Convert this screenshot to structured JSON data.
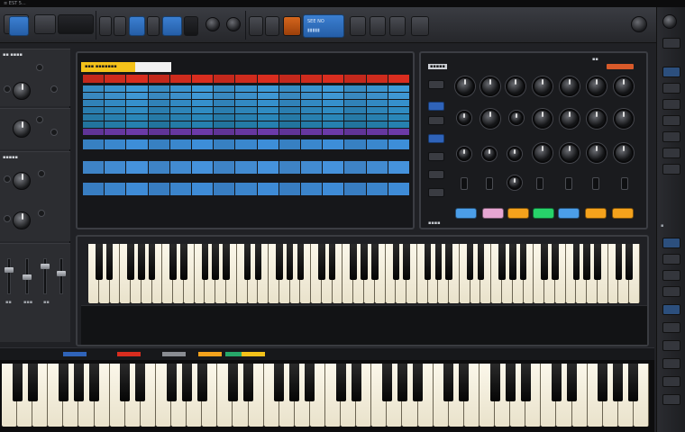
{
  "menu": {
    "text": "≡ EST 5..."
  },
  "toolbar": {
    "tab_label": "SEE NO",
    "tab_sub": "▮▮▮▮▮"
  },
  "left_panel": {
    "section_1_title": "▪▪ ▪▪▪▪",
    "section_2_title": "▪▪▪▪▪",
    "fader_labels": [
      "▪▪",
      "▪▪▪",
      "▪▪"
    ]
  },
  "grid": {
    "header_tag": "▪▪▪ ▪▪▪▪▪▪▪",
    "columns": 15,
    "rows": [
      {
        "color": "#d92d1f"
      },
      {
        "color": "#3d9bd8"
      },
      {
        "color": "#3f97d4"
      },
      {
        "color": "#3590cc"
      },
      {
        "color": "#2f8bc2"
      },
      {
        "color": "#2a86b8"
      },
      {
        "color": "#2681b0"
      },
      {
        "color": "#6b3aa8"
      },
      {
        "color": "#3d8ed8"
      },
      {
        "color": "#4592dc"
      },
      {
        "color": "#3e8bd6"
      }
    ]
  },
  "synth": {
    "top_label": "▪▪▪▪▪",
    "top_right_label": "▪▪",
    "knob_label": "▪▪▪▪",
    "pads": [
      {
        "color": "#4b9ee8"
      },
      {
        "color": "#e6a6d2"
      },
      {
        "color": "#f4a21c"
      },
      {
        "color": "#27d36a"
      },
      {
        "color": "#4b9ee8"
      },
      {
        "color": "#f4a21c"
      },
      {
        "color": "#f4a21c"
      }
    ]
  },
  "right_rail": {
    "label": "▪"
  },
  "bottom_strip": {
    "chips": [
      {
        "color": "#2f63b9"
      },
      {
        "color": "#d92d1f"
      },
      {
        "color": "#8a8d93"
      },
      {
        "color": "#f4a21c"
      },
      {
        "color": "#27a86a"
      },
      {
        "color": "#f4c21a"
      }
    ]
  }
}
